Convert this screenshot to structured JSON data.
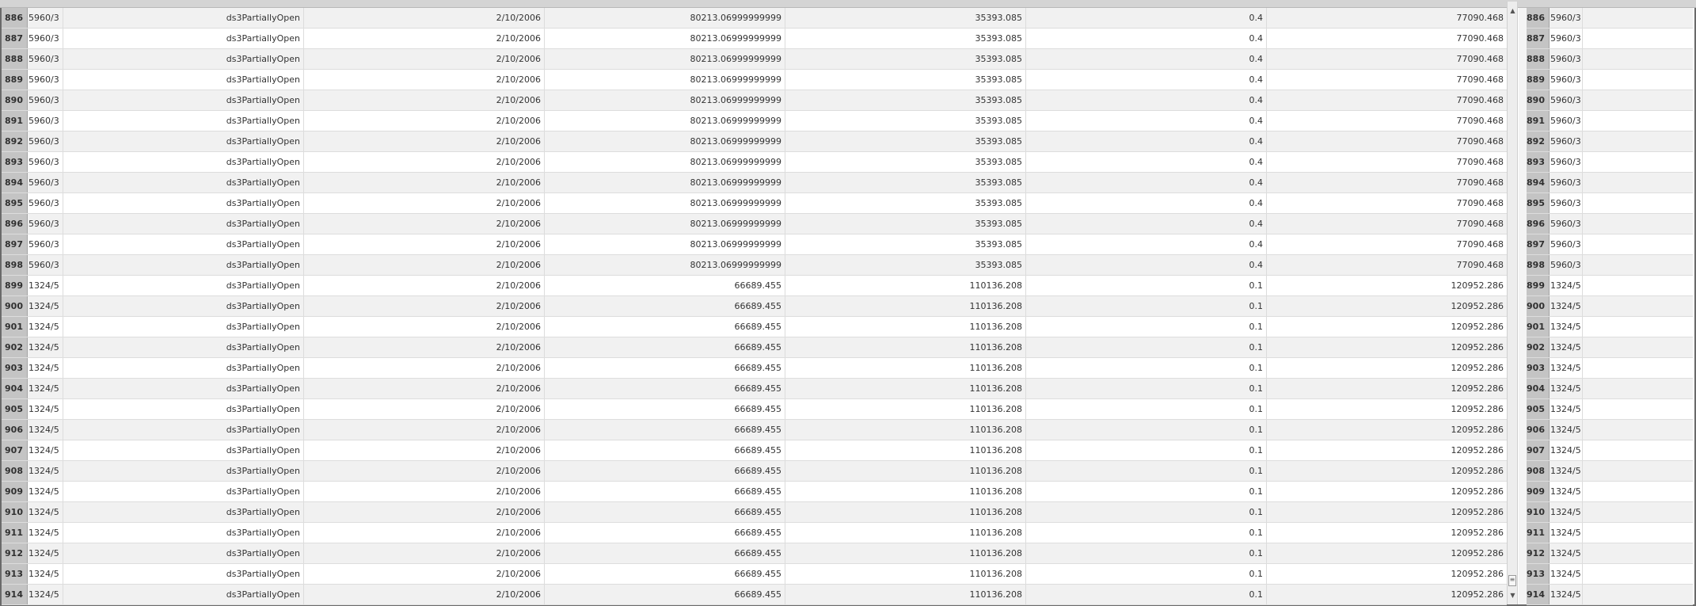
{
  "colors": {
    "row_even": "#f1f1f1",
    "row_odd": "#ffffff",
    "row_header": "#c4c4c4",
    "grid_line": "#dddddd",
    "frame": "#6a6a6a"
  },
  "icons": {
    "scroll_up": "triangle-up-icon",
    "scroll_down": "triangle-down-icon",
    "scroll_thumb": "grip-lines-icon"
  },
  "scroll_glyphs": {
    "up": "▲",
    "down": "▼",
    "thumb": "≡"
  },
  "grid": {
    "rows": [
      {
        "num": "886",
        "id": "5960/3",
        "status": "ds3PartiallyOpen",
        "date": "2/10/2006",
        "v1": "80213.06999999999",
        "v2": "35393.085",
        "v3": "0.4",
        "v4": "77090.468"
      },
      {
        "num": "887",
        "id": "5960/3",
        "status": "ds3PartiallyOpen",
        "date": "2/10/2006",
        "v1": "80213.06999999999",
        "v2": "35393.085",
        "v3": "0.4",
        "v4": "77090.468"
      },
      {
        "num": "888",
        "id": "5960/3",
        "status": "ds3PartiallyOpen",
        "date": "2/10/2006",
        "v1": "80213.06999999999",
        "v2": "35393.085",
        "v3": "0.4",
        "v4": "77090.468"
      },
      {
        "num": "889",
        "id": "5960/3",
        "status": "ds3PartiallyOpen",
        "date": "2/10/2006",
        "v1": "80213.06999999999",
        "v2": "35393.085",
        "v3": "0.4",
        "v4": "77090.468"
      },
      {
        "num": "890",
        "id": "5960/3",
        "status": "ds3PartiallyOpen",
        "date": "2/10/2006",
        "v1": "80213.06999999999",
        "v2": "35393.085",
        "v3": "0.4",
        "v4": "77090.468"
      },
      {
        "num": "891",
        "id": "5960/3",
        "status": "ds3PartiallyOpen",
        "date": "2/10/2006",
        "v1": "80213.06999999999",
        "v2": "35393.085",
        "v3": "0.4",
        "v4": "77090.468"
      },
      {
        "num": "892",
        "id": "5960/3",
        "status": "ds3PartiallyOpen",
        "date": "2/10/2006",
        "v1": "80213.06999999999",
        "v2": "35393.085",
        "v3": "0.4",
        "v4": "77090.468"
      },
      {
        "num": "893",
        "id": "5960/3",
        "status": "ds3PartiallyOpen",
        "date": "2/10/2006",
        "v1": "80213.06999999999",
        "v2": "35393.085",
        "v3": "0.4",
        "v4": "77090.468"
      },
      {
        "num": "894",
        "id": "5960/3",
        "status": "ds3PartiallyOpen",
        "date": "2/10/2006",
        "v1": "80213.06999999999",
        "v2": "35393.085",
        "v3": "0.4",
        "v4": "77090.468"
      },
      {
        "num": "895",
        "id": "5960/3",
        "status": "ds3PartiallyOpen",
        "date": "2/10/2006",
        "v1": "80213.06999999999",
        "v2": "35393.085",
        "v3": "0.4",
        "v4": "77090.468"
      },
      {
        "num": "896",
        "id": "5960/3",
        "status": "ds3PartiallyOpen",
        "date": "2/10/2006",
        "v1": "80213.06999999999",
        "v2": "35393.085",
        "v3": "0.4",
        "v4": "77090.468"
      },
      {
        "num": "897",
        "id": "5960/3",
        "status": "ds3PartiallyOpen",
        "date": "2/10/2006",
        "v1": "80213.06999999999",
        "v2": "35393.085",
        "v3": "0.4",
        "v4": "77090.468"
      },
      {
        "num": "898",
        "id": "5960/3",
        "status": "ds3PartiallyOpen",
        "date": "2/10/2006",
        "v1": "80213.06999999999",
        "v2": "35393.085",
        "v3": "0.4",
        "v4": "77090.468"
      },
      {
        "num": "899",
        "id": "1324/5",
        "status": "ds3PartiallyOpen",
        "date": "2/10/2006",
        "v1": "66689.455",
        "v2": "110136.208",
        "v3": "0.1",
        "v4": "120952.286"
      },
      {
        "num": "900",
        "id": "1324/5",
        "status": "ds3PartiallyOpen",
        "date": "2/10/2006",
        "v1": "66689.455",
        "v2": "110136.208",
        "v3": "0.1",
        "v4": "120952.286"
      },
      {
        "num": "901",
        "id": "1324/5",
        "status": "ds3PartiallyOpen",
        "date": "2/10/2006",
        "v1": "66689.455",
        "v2": "110136.208",
        "v3": "0.1",
        "v4": "120952.286"
      },
      {
        "num": "902",
        "id": "1324/5",
        "status": "ds3PartiallyOpen",
        "date": "2/10/2006",
        "v1": "66689.455",
        "v2": "110136.208",
        "v3": "0.1",
        "v4": "120952.286"
      },
      {
        "num": "903",
        "id": "1324/5",
        "status": "ds3PartiallyOpen",
        "date": "2/10/2006",
        "v1": "66689.455",
        "v2": "110136.208",
        "v3": "0.1",
        "v4": "120952.286"
      },
      {
        "num": "904",
        "id": "1324/5",
        "status": "ds3PartiallyOpen",
        "date": "2/10/2006",
        "v1": "66689.455",
        "v2": "110136.208",
        "v3": "0.1",
        "v4": "120952.286"
      },
      {
        "num": "905",
        "id": "1324/5",
        "status": "ds3PartiallyOpen",
        "date": "2/10/2006",
        "v1": "66689.455",
        "v2": "110136.208",
        "v3": "0.1",
        "v4": "120952.286"
      },
      {
        "num": "906",
        "id": "1324/5",
        "status": "ds3PartiallyOpen",
        "date": "2/10/2006",
        "v1": "66689.455",
        "v2": "110136.208",
        "v3": "0.1",
        "v4": "120952.286"
      },
      {
        "num": "907",
        "id": "1324/5",
        "status": "ds3PartiallyOpen",
        "date": "2/10/2006",
        "v1": "66689.455",
        "v2": "110136.208",
        "v3": "0.1",
        "v4": "120952.286"
      },
      {
        "num": "908",
        "id": "1324/5",
        "status": "ds3PartiallyOpen",
        "date": "2/10/2006",
        "v1": "66689.455",
        "v2": "110136.208",
        "v3": "0.1",
        "v4": "120952.286"
      },
      {
        "num": "909",
        "id": "1324/5",
        "status": "ds3PartiallyOpen",
        "date": "2/10/2006",
        "v1": "66689.455",
        "v2": "110136.208",
        "v3": "0.1",
        "v4": "120952.286"
      },
      {
        "num": "910",
        "id": "1324/5",
        "status": "ds3PartiallyOpen",
        "date": "2/10/2006",
        "v1": "66689.455",
        "v2": "110136.208",
        "v3": "0.1",
        "v4": "120952.286"
      },
      {
        "num": "911",
        "id": "1324/5",
        "status": "ds3PartiallyOpen",
        "date": "2/10/2006",
        "v1": "66689.455",
        "v2": "110136.208",
        "v3": "0.1",
        "v4": "120952.286"
      },
      {
        "num": "912",
        "id": "1324/5",
        "status": "ds3PartiallyOpen",
        "date": "2/10/2006",
        "v1": "66689.455",
        "v2": "110136.208",
        "v3": "0.1",
        "v4": "120952.286"
      },
      {
        "num": "913",
        "id": "1324/5",
        "status": "ds3PartiallyOpen",
        "date": "2/10/2006",
        "v1": "66689.455",
        "v2": "110136.208",
        "v3": "0.1",
        "v4": "120952.286"
      },
      {
        "num": "914",
        "id": "1324/5",
        "status": "ds3PartiallyOpen",
        "date": "2/10/2006",
        "v1": "66689.455",
        "v2": "110136.208",
        "v3": "0.1",
        "v4": "120952.286"
      }
    ]
  }
}
